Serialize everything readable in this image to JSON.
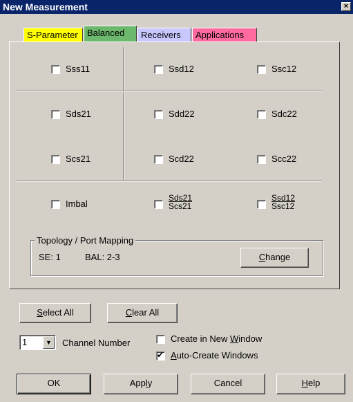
{
  "window": {
    "title": "New Measurement",
    "close_label": "×"
  },
  "tabs": [
    {
      "label": "S-Parameter",
      "color": "#ffff00"
    },
    {
      "label": "Balanced",
      "color": "#6cb86c"
    },
    {
      "label": "Receivers",
      "color": "#c8c8ff"
    },
    {
      "label": "Applications",
      "color": "#ff6aa0"
    }
  ],
  "active_tab": "Balanced",
  "grid": {
    "row1": [
      "Sss11",
      "Ssd12",
      "Ssc12"
    ],
    "row2": [
      "Sds21",
      "Sdd22",
      "Sdc22"
    ],
    "row3": [
      "Scs21",
      "Scd22",
      "Scc22"
    ],
    "row4": {
      "imbal": "Imbal",
      "ratio1_num": "Sds21",
      "ratio1_den": "Scs21",
      "ratio2_num": "Ssd12",
      "ratio2_den": "Ssc12"
    }
  },
  "topology": {
    "title": "Topology / Port Mapping",
    "se": "SE: 1",
    "bal": "BAL: 2-3",
    "change_pre": "",
    "change_key": "C",
    "change_post": "hange"
  },
  "buttons": {
    "select_all_key": "S",
    "select_all_rest": "elect All",
    "clear_all_key": "C",
    "clear_all_rest": "lear All",
    "ok": "OK",
    "apply_pre": "App",
    "apply_key": "l",
    "apply_post": "y",
    "cancel": "Cancel",
    "help_key": "H",
    "help_rest": "elp"
  },
  "channel": {
    "value": "1",
    "label": "Channel Number",
    "arrow": "▼"
  },
  "options": {
    "create_new_window_pre": "Create in New ",
    "create_new_window_key": "W",
    "create_new_window_post": "indow",
    "create_new_window_checked": false,
    "auto_create_key": "A",
    "auto_create_rest": "uto-Create Windows",
    "auto_create_checked": true
  }
}
